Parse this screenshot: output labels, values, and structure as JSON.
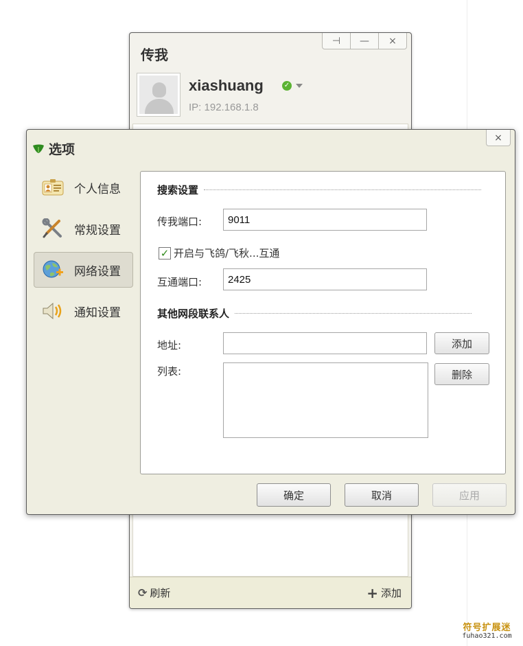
{
  "main_window": {
    "title": "传我",
    "buttons": {
      "pin": "⊣",
      "minimize": "—",
      "close": "×"
    },
    "user": {
      "name": "xiashuang",
      "ip": "IP: 192.168.1.8",
      "status": "online"
    },
    "bottom": {
      "refresh": "刷新",
      "add": "添加"
    }
  },
  "dialog": {
    "title": "选项",
    "close": "×",
    "nav": [
      {
        "label": "个人信息",
        "icon": "id-card-icon",
        "active": false
      },
      {
        "label": "常规设置",
        "icon": "tools-icon",
        "active": false
      },
      {
        "label": "网络设置",
        "icon": "network-icon",
        "active": true
      },
      {
        "label": "通知设置",
        "icon": "speaker-icon",
        "active": false
      }
    ],
    "network": {
      "search_section": "搜索设置",
      "port_label": "传我端口:",
      "port_value": "9011",
      "interop_checkbox": {
        "label": "开启与飞鸽/飞秋...互通",
        "checked": true
      },
      "interop_port_label": "互通端口:",
      "interop_port_value": "2425",
      "contacts_section": "其他网段联系人",
      "address_label": "地址:",
      "address_value": "",
      "list_label": "列表:",
      "add_button": "添加",
      "delete_button": "删除"
    },
    "footer": {
      "ok": "确定",
      "cancel": "取消",
      "apply": "应用"
    }
  },
  "watermark": {
    "line1": "符号扩展迷",
    "line2": "fuhao321.com"
  },
  "colors": {
    "dialog_bg": "#efeee1",
    "accent_green": "#5bb333",
    "leaf_green": "#2e8b1f"
  }
}
